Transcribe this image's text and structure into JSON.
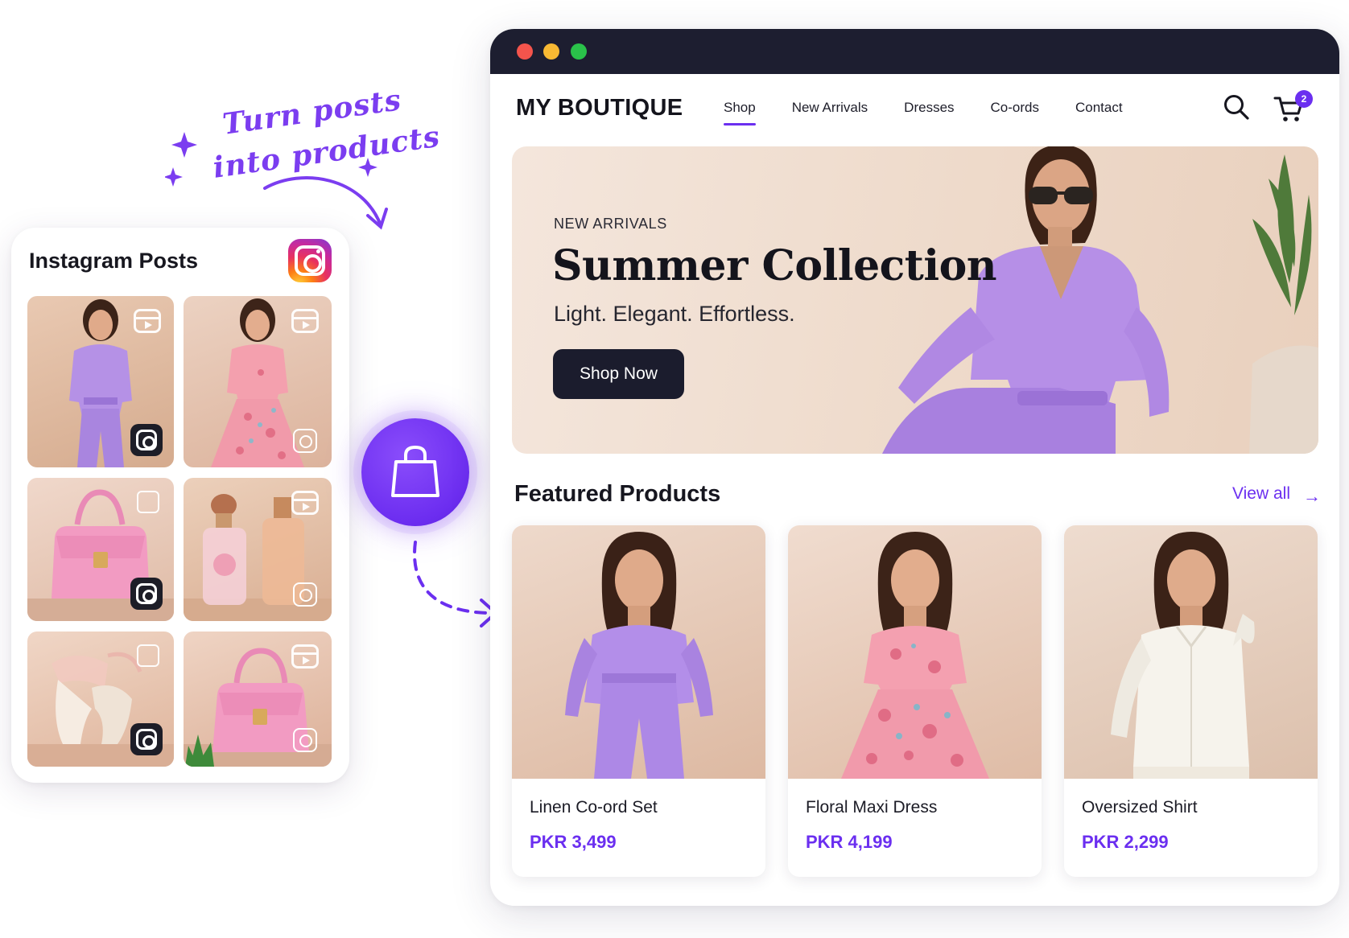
{
  "annotation": {
    "line1": "Turn posts",
    "line2": "into products"
  },
  "instagram": {
    "title": "Instagram Posts",
    "posts": [
      {
        "subject": "lavender co-ord set",
        "type": "reel"
      },
      {
        "subject": "floral maxi dress",
        "type": "reel"
      },
      {
        "subject": "pink handbag",
        "type": "post"
      },
      {
        "subject": "perfume bottles",
        "type": "reel"
      },
      {
        "subject": "heels",
        "type": "post"
      },
      {
        "subject": "pink handbag",
        "type": "reel"
      }
    ]
  },
  "store": {
    "brand": "MY BOUTIQUE",
    "nav": [
      "Shop",
      "New Arrivals",
      "Dresses",
      "Co-ords",
      "Contact"
    ],
    "active_nav": "Shop",
    "cart_count": "2",
    "hero": {
      "eyebrow": "NEW ARRIVALS",
      "title": "Summer Collection",
      "tagline": "Light. Elegant. Effortless.",
      "cta": "Shop Now"
    },
    "featured": {
      "title": "Featured Products",
      "view_all": "View all",
      "products": [
        {
          "name": "Linen Co-ord Set",
          "price": "PKR 3,499",
          "outfit_color": "#b38ee9"
        },
        {
          "name": "Floral Maxi Dress",
          "price": "PKR 4,199",
          "outfit_color": "#f4a0b0"
        },
        {
          "name": "Oversized Shirt",
          "price": "PKR 2,299",
          "outfit_color": "#f6f3ec"
        }
      ]
    }
  },
  "colors": {
    "accent": "#6b2ff0",
    "titlebar": "#1d1e30",
    "cta_bg": "#1b1c2d",
    "traffic_red": "#f4544c",
    "traffic_yellow": "#f8b933",
    "traffic_green": "#2ac24a"
  },
  "icons": [
    "sparkle-icon",
    "curved-arrow-icon",
    "instagram-logo-icon",
    "reel-icon",
    "post-icon",
    "shopping-bag-icon",
    "dashed-arrow-icon",
    "search-icon",
    "cart-icon",
    "arrow-right-icon"
  ]
}
